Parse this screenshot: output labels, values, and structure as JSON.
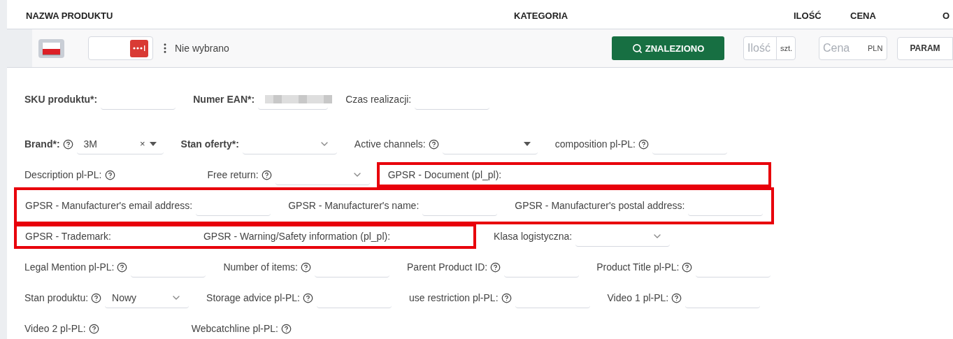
{
  "columns": [
    {
      "label": "NAZWA PRODUKTU"
    },
    {
      "label": "KATEGORIA"
    },
    {
      "label": "ILOŚĆ"
    },
    {
      "label": "CENA"
    },
    {
      "label": "O"
    }
  ],
  "toolbar": {
    "status": "Nie wybrano",
    "search_button": "ZNALEZIONO",
    "quantity": {
      "placeholder": "Ilość",
      "unit": "szt."
    },
    "price": {
      "placeholder": "Cena",
      "currency": "PLN"
    },
    "param_button": "PARAM"
  },
  "rows": [
    {
      "items": [
        {
          "kind": "text",
          "label": "SKU produktu*:",
          "required": true,
          "help": false
        },
        {
          "kind": "redacted",
          "label": "Numer EAN*:",
          "required": true,
          "help": false
        },
        {
          "kind": "text",
          "label": "Czas realizacji:",
          "required": false,
          "help": false
        }
      ]
    },
    {
      "items": [
        {
          "kind": "combo",
          "label": "Brand*:",
          "required": true,
          "help": true,
          "value": "3M",
          "clear": "×"
        },
        {
          "kind": "select",
          "label": "Stan oferty*:",
          "required": true,
          "help": false
        },
        {
          "kind": "dropdown",
          "label": "Active channels:",
          "required": false,
          "help": true
        },
        {
          "kind": "text",
          "label": "composition pl-PL:",
          "required": false,
          "help": true
        }
      ]
    },
    {
      "items": [
        {
          "kind": "bare",
          "label": "Description pl-PL:",
          "required": false,
          "help": true
        },
        {
          "kind": "select",
          "label": "Free return:",
          "required": false,
          "help": true
        },
        {
          "kind": "highlight",
          "fields": [
            {
              "kind": "wide",
              "label": "GPSR - Document (pl_pl):",
              "required": false,
              "help": false
            }
          ]
        }
      ]
    },
    {
      "items": [
        {
          "kind": "highlight",
          "fields": [
            {
              "kind": "text",
              "label": "GPSR - Manufacturer's email address:",
              "required": false,
              "help": false
            },
            {
              "kind": "text",
              "label": "GPSR - Manufacturer's name:",
              "required": false,
              "help": false
            },
            {
              "kind": "text",
              "label": "GPSR - Manufacturer's postal address:",
              "required": false,
              "help": false
            }
          ]
        }
      ]
    },
    {
      "items": [
        {
          "kind": "highlight",
          "fields": [
            {
              "kind": "bare",
              "label": "GPSR - Trademark:",
              "required": false,
              "help": false
            },
            {
              "kind": "bare",
              "label": "GPSR - Warning/Safety information (pl_pl):",
              "required": false,
              "help": false
            }
          ]
        },
        {
          "kind": "select",
          "label": "Klasa logistyczna:",
          "required": false,
          "help": false
        }
      ]
    },
    {
      "items": [
        {
          "kind": "text",
          "label": "Legal Mention pl-PL:",
          "required": false,
          "help": true
        },
        {
          "kind": "text",
          "label": "Number of items:",
          "required": false,
          "help": true
        },
        {
          "kind": "text",
          "label": "Parent Product ID:",
          "required": false,
          "help": true
        },
        {
          "kind": "text",
          "label": "Product Title pl-PL:",
          "required": false,
          "help": true
        }
      ]
    },
    {
      "items": [
        {
          "kind": "select",
          "label": "Stan produktu:",
          "required": false,
          "help": true,
          "value": "Nowy"
        },
        {
          "kind": "text",
          "label": "Storage advice pl-PL:",
          "required": false,
          "help": true
        },
        {
          "kind": "text",
          "label": "use restriction pl-PL:",
          "required": false,
          "help": true
        },
        {
          "kind": "text",
          "label": "Video 1 pl-PL:",
          "required": false,
          "help": true
        }
      ]
    },
    {
      "items": [
        {
          "kind": "bare",
          "label": "Video 2 pl-PL:",
          "required": false,
          "help": true
        },
        {
          "kind": "bare",
          "label": "Webcatchline pl-PL:",
          "required": false,
          "help": true
        }
      ]
    }
  ]
}
